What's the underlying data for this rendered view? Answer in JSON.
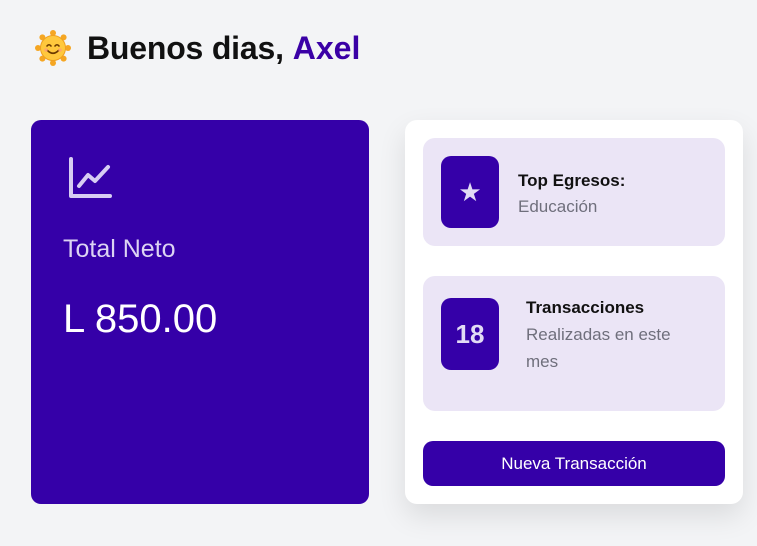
{
  "greeting": {
    "prefix": "Buenos dias,",
    "name": "Axel",
    "icon": "sun-smile-icon"
  },
  "total_card": {
    "icon": "line-chart-icon",
    "label": "Total Neto",
    "value": "L 850.00"
  },
  "top_expenses": {
    "icon": "star-icon",
    "title": "Top Egresos:",
    "category": "Educación"
  },
  "transactions": {
    "count": "18",
    "title": "Transacciones",
    "subtitle": "Realizadas en este mes"
  },
  "actions": {
    "new_transaction_label": "Nueva Transacción"
  },
  "colors": {
    "primary": "#3500a8",
    "card_bg": "#ebe5f6",
    "page_bg": "#f3f4f6",
    "name_accent": "#3a00a6"
  }
}
